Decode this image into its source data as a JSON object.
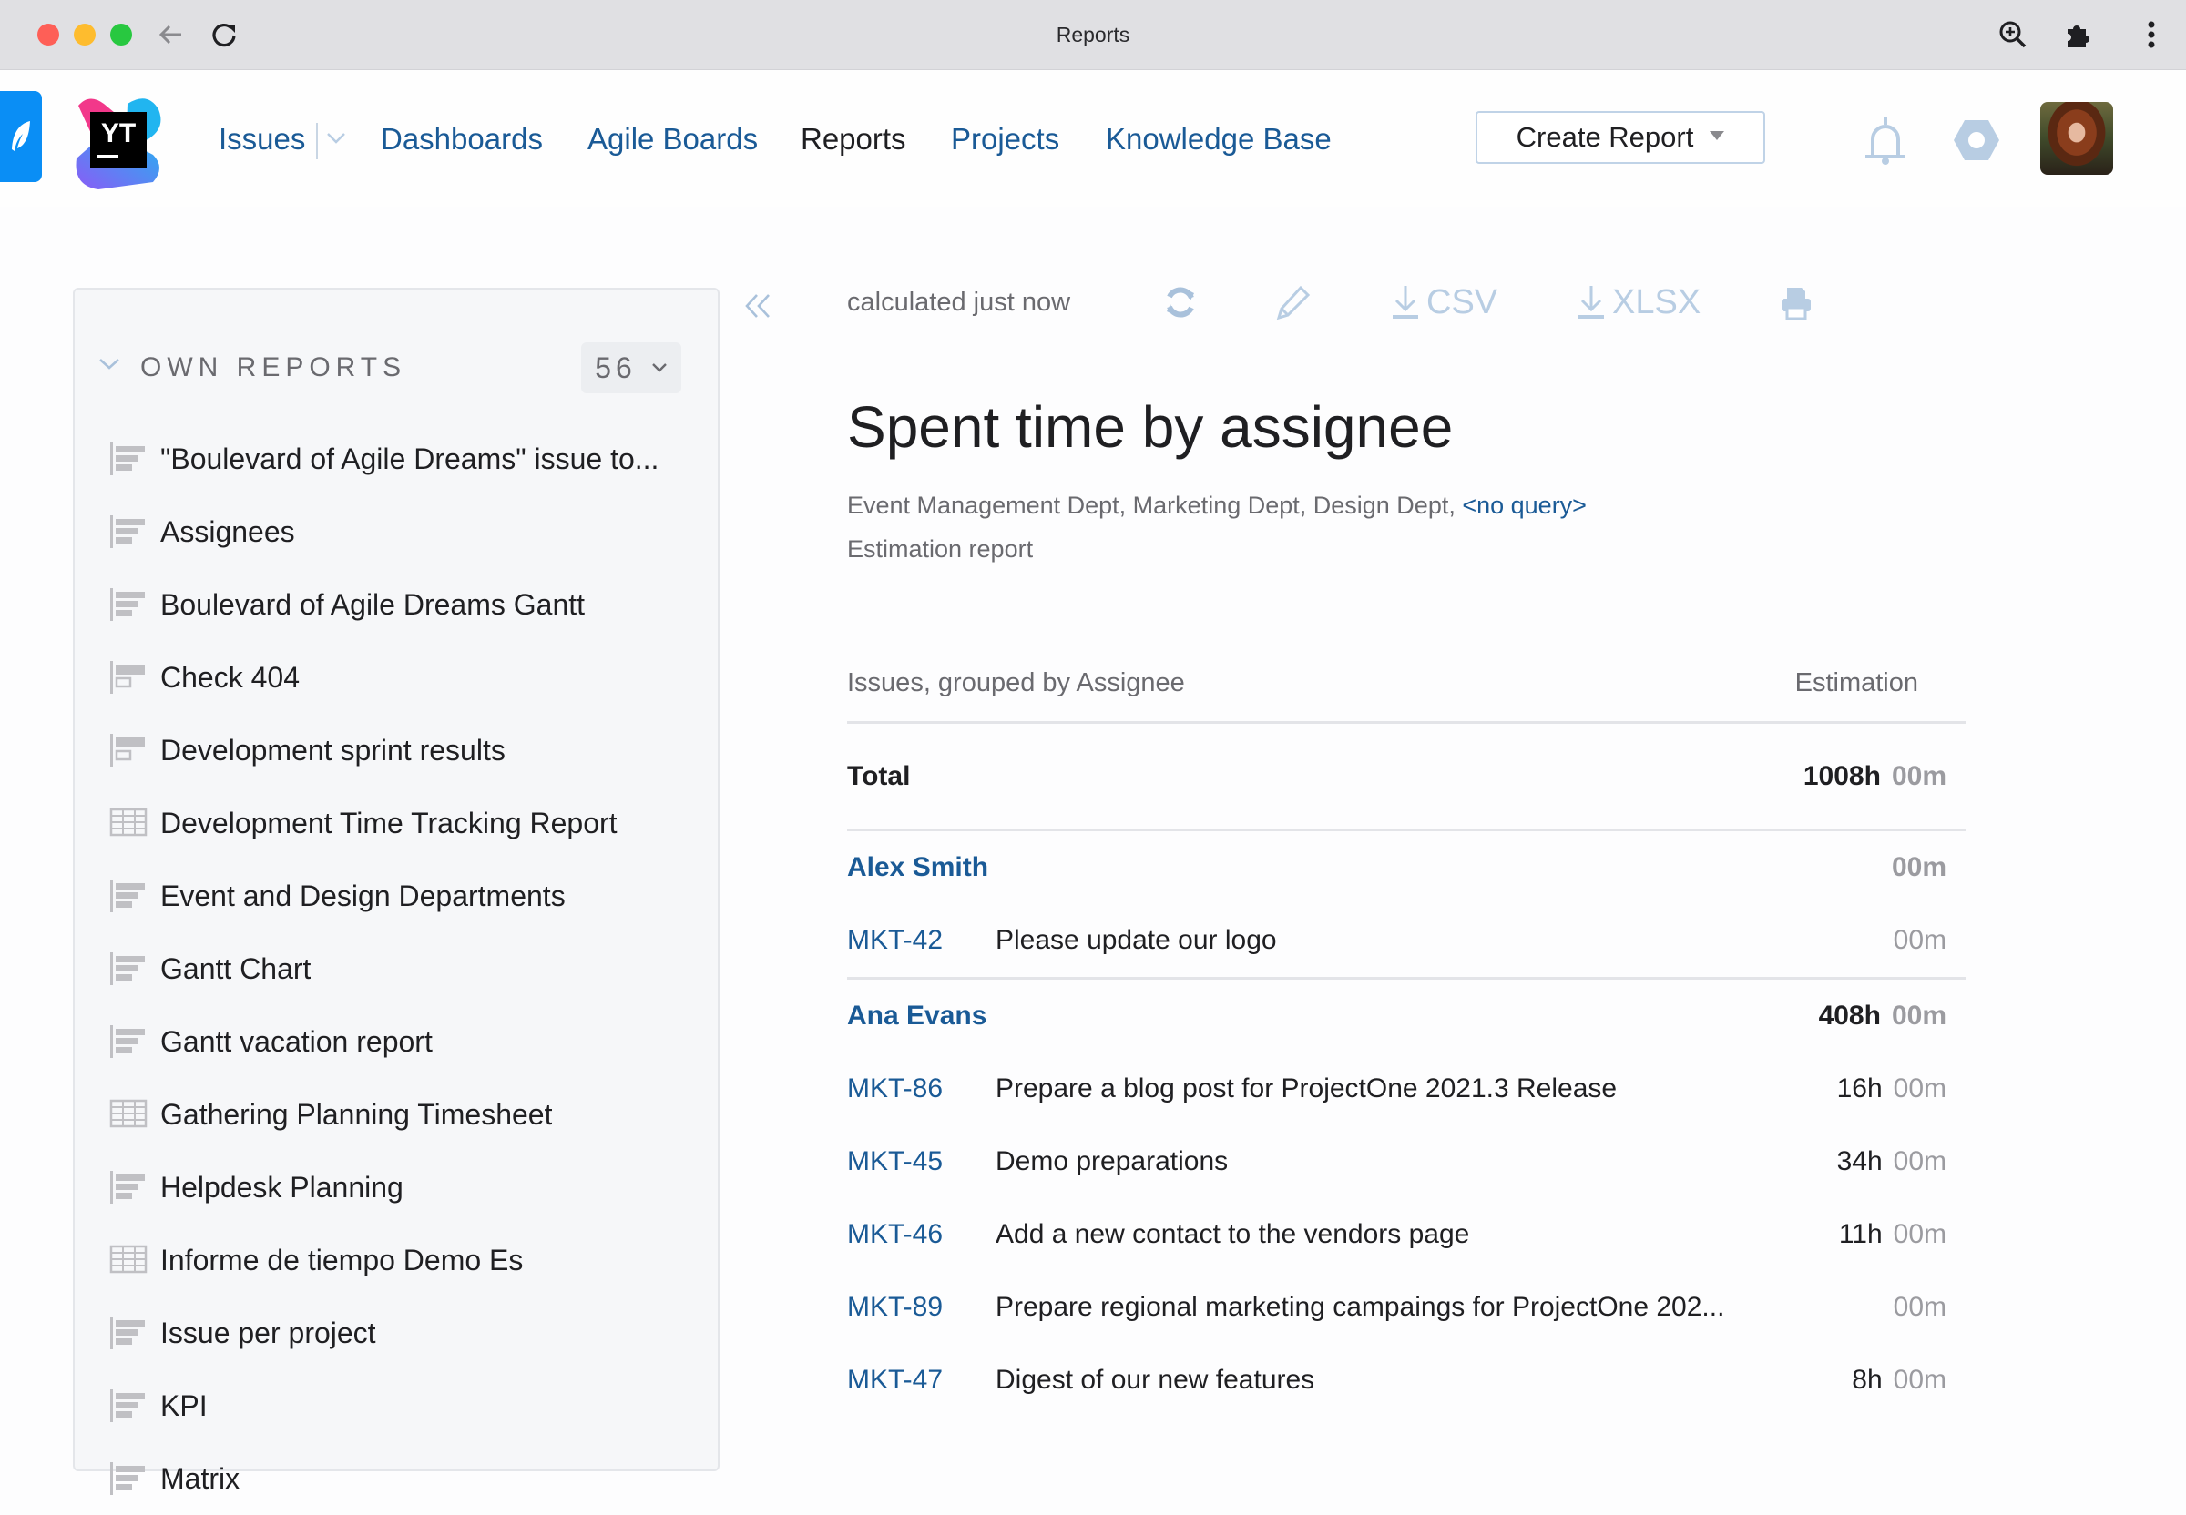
{
  "browser": {
    "window_title": "Reports",
    "icons": [
      "back-arrow-icon",
      "reload-icon",
      "zoom-icon",
      "extensions-puzzle-icon",
      "more-vertical-icon"
    ]
  },
  "nav": {
    "items": [
      {
        "label": "Issues",
        "active": false,
        "has_dropdown": true
      },
      {
        "label": "Dashboards",
        "active": false
      },
      {
        "label": "Agile Boards",
        "active": false
      },
      {
        "label": "Reports",
        "active": true
      },
      {
        "label": "Projects",
        "active": false
      },
      {
        "label": "Knowledge Base",
        "active": false
      }
    ],
    "create_button": "Create Report",
    "logo_text": "YT"
  },
  "sidebar": {
    "section_title": "OWN REPORTS",
    "count": "56",
    "items": [
      {
        "label": "\"Boulevard of Agile Dreams\" issue to...",
        "icon": "bar-chart"
      },
      {
        "label": "Assignees",
        "icon": "bar-chart"
      },
      {
        "label": "Boulevard of Agile Dreams Gantt",
        "icon": "bar-chart"
      },
      {
        "label": "Check 404",
        "icon": "gantt"
      },
      {
        "label": "Development sprint results",
        "icon": "gantt"
      },
      {
        "label": "Development Time Tracking Report",
        "icon": "table"
      },
      {
        "label": "Event and Design Departments",
        "icon": "bar-chart"
      },
      {
        "label": "Gantt Chart",
        "icon": "bar-chart"
      },
      {
        "label": "Gantt vacation report",
        "icon": "bar-chart"
      },
      {
        "label": "Gathering Planning Timesheet",
        "icon": "table"
      },
      {
        "label": "Helpdesk Planning",
        "icon": "bar-chart"
      },
      {
        "label": "Informe de tiempo Demo Es",
        "icon": "table"
      },
      {
        "label": "Issue per project",
        "icon": "bar-chart"
      },
      {
        "label": "KPI",
        "icon": "bar-chart"
      },
      {
        "label": "Matrix",
        "icon": "bar-chart"
      }
    ]
  },
  "toolbar": {
    "calculated": "calculated just now",
    "csv": "CSV",
    "xlsx": "XLSX"
  },
  "report": {
    "title": "Spent time by assignee",
    "projects": "Event Management Dept, Marketing Dept, Design Dept, ",
    "query_link": "<no query>",
    "type": "Estimation report",
    "table": {
      "col_group": "Issues, grouped by Assignee",
      "col_value": "Estimation",
      "total": {
        "label": "Total",
        "hours": "1008h",
        "minutes": "00m"
      },
      "groups": [
        {
          "assignee": "Alex Smith",
          "hours": "",
          "minutes": "00m",
          "issues": [
            {
              "id": "MKT-42",
              "summary": "Please update our logo",
              "hours": "",
              "minutes": "00m"
            }
          ]
        },
        {
          "assignee": "Ana Evans",
          "hours": "408h",
          "minutes": "00m",
          "issues": [
            {
              "id": "MKT-86",
              "summary": "Prepare a blog post for ProjectOne 2021.3 Release",
              "hours": "16h",
              "minutes": "00m"
            },
            {
              "id": "MKT-45",
              "summary": "Demo preparations",
              "hours": "34h",
              "minutes": "00m"
            },
            {
              "id": "MKT-46",
              "summary": "Add a new contact to the vendors page",
              "hours": "11h",
              "minutes": "00m"
            },
            {
              "id": "MKT-89",
              "summary": "Prepare regional marketing campaings for ProjectOne 202...",
              "hours": "",
              "minutes": "00m"
            },
            {
              "id": "MKT-47",
              "summary": "Digest of our new features",
              "hours": "8h",
              "minutes": "00m"
            }
          ]
        }
      ]
    }
  },
  "colors": {
    "link": "#1a5a96",
    "muted_icon": "#b8cde3",
    "text": "#1f1f22",
    "secondary_text": "#6a6a6f"
  }
}
